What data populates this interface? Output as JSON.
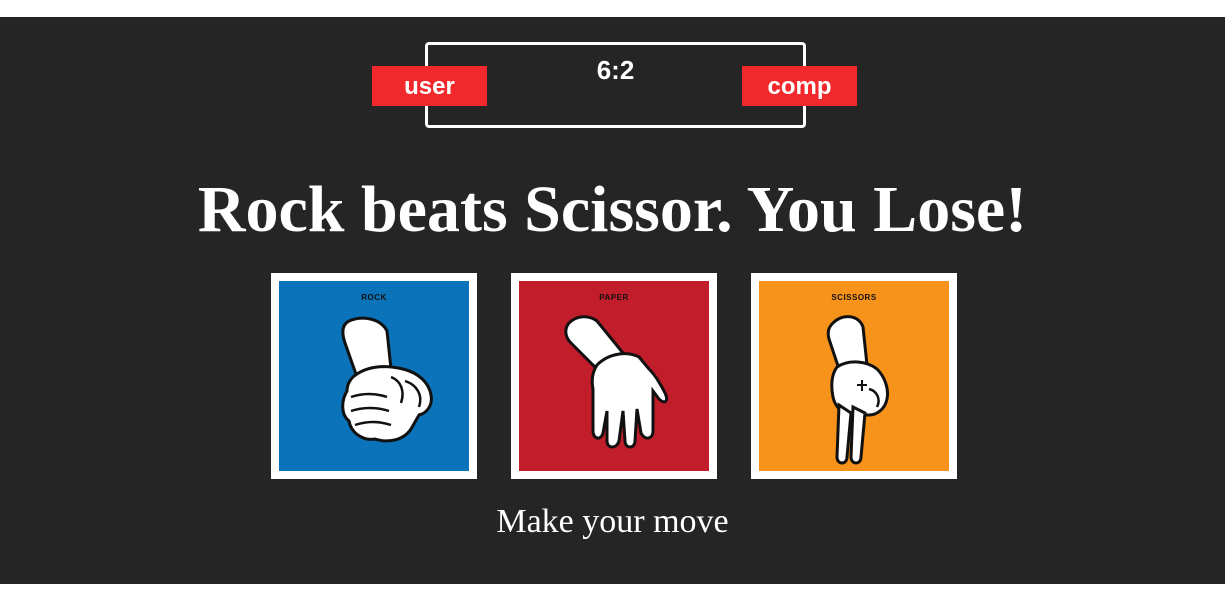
{
  "scoreboard": {
    "score": "6:2",
    "user_label": "user",
    "comp_label": "comp",
    "badge_color": "#f2292c"
  },
  "result_message": "Rock beats Scissor. You Lose!",
  "choices": [
    {
      "label": "ROCK",
      "icon": "rock-fist-icon",
      "color": "#0a73b9"
    },
    {
      "label": "PAPER",
      "icon": "paper-hand-icon",
      "color": "#c21d2b"
    },
    {
      "label": "SCISSORS",
      "icon": "scissors-hand-icon",
      "color": "#f7931b"
    }
  ],
  "prompt": "Make your move"
}
